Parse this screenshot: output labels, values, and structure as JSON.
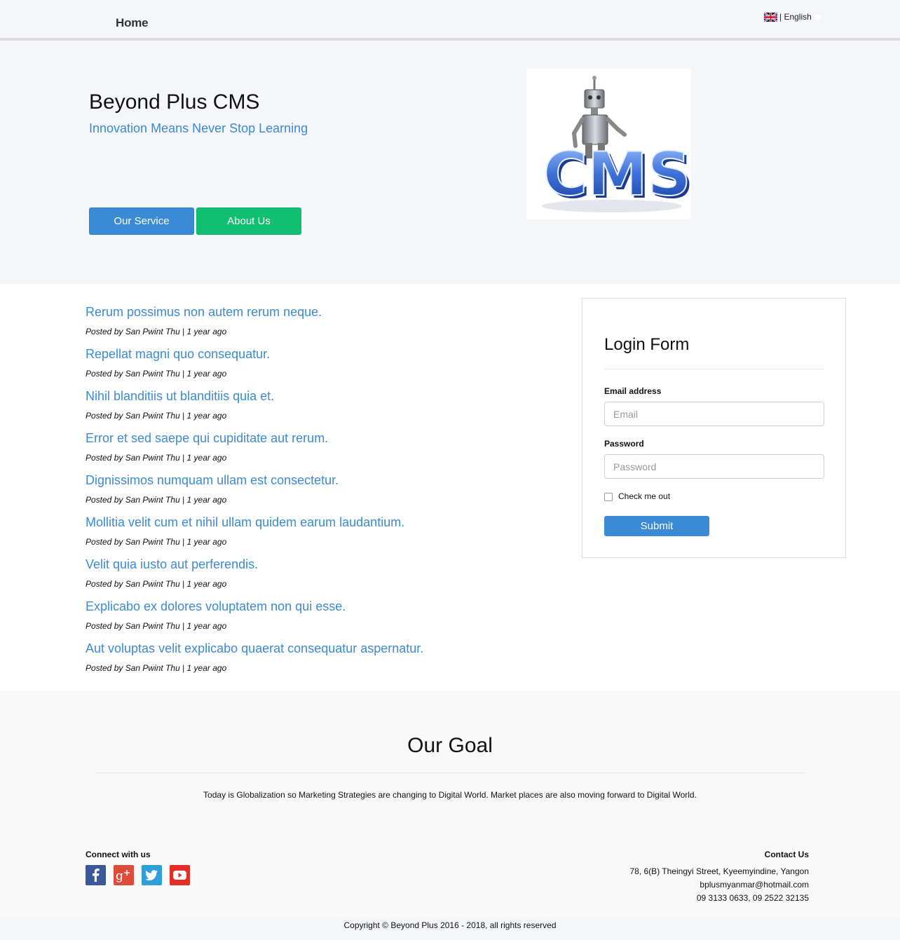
{
  "nav": {
    "home_label": "Home",
    "language_label": "| English",
    "flag_icon": "uk-flag-icon"
  },
  "hero": {
    "title": "Beyond Plus CMS",
    "subtitle": "Innovation Means Never Stop Learning",
    "service_button": "Our Service",
    "about_button": "About Us",
    "image_alt": "CMS",
    "colors": {
      "primary": "#3a8ad6",
      "success": "#11bf71"
    }
  },
  "posts": [
    {
      "title": "Rerum possimus non autem rerum neque.",
      "author": "San Pwint Thu",
      "time": "1 year ago"
    },
    {
      "title": "Repellat magni quo consequatur.",
      "author": "San Pwint Thu",
      "time": "1 year ago"
    },
    {
      "title": "Nihil blanditiis ut blanditiis quia et.",
      "author": "San Pwint Thu",
      "time": "1 year ago"
    },
    {
      "title": "Error et sed saepe qui cupiditate aut rerum.",
      "author": "San Pwint Thu",
      "time": "1 year ago"
    },
    {
      "title": "Dignissimos numquam ullam est consectetur.",
      "author": "San Pwint Thu",
      "time": "1 year ago"
    },
    {
      "title": "Mollitia velit cum et nihil ullam quidem earum laudantium.",
      "author": "San Pwint Thu",
      "time": "1 year ago"
    },
    {
      "title": "Velit quia iusto aut perferendis.",
      "author": "San Pwint Thu",
      "time": "1 year ago"
    },
    {
      "title": "Explicabo ex dolores voluptatem non qui esse.",
      "author": "San Pwint Thu",
      "time": "1 year ago"
    },
    {
      "title": "Aut voluptas velit explicabo quaerat consequatur aspernatur.",
      "author": "San Pwint Thu",
      "time": "1 year ago"
    }
  ],
  "post_meta_prefix": "Posted by ",
  "post_meta_sep": " | ",
  "login": {
    "title": "Login Form",
    "email_label": "Email address",
    "email_placeholder": "Email",
    "password_label": "Password",
    "password_placeholder": "Password",
    "check_label": "Check me out",
    "submit_label": "Submit"
  },
  "goal": {
    "title": "Our Goal",
    "text": "Today is Globalization so Marketing Strategies are changing to Digital World. Market places are also moving forward to Digital World."
  },
  "connect": {
    "title": "Connect with us",
    "icons": [
      "facebook-icon",
      "google-plus-icon",
      "twitter-icon",
      "youtube-icon"
    ]
  },
  "contact": {
    "title": "Contact Us",
    "address": "78, 6(B) Theingyi Street, Kyeemyindine, Yangon",
    "email": "bplusmyanmar@hotmail.com",
    "phone": "09 3133 0633, 09 2522 32135"
  },
  "footer": {
    "copyright": "Copyright © Beyond Plus 2016 - 2018, all rights reserved"
  }
}
